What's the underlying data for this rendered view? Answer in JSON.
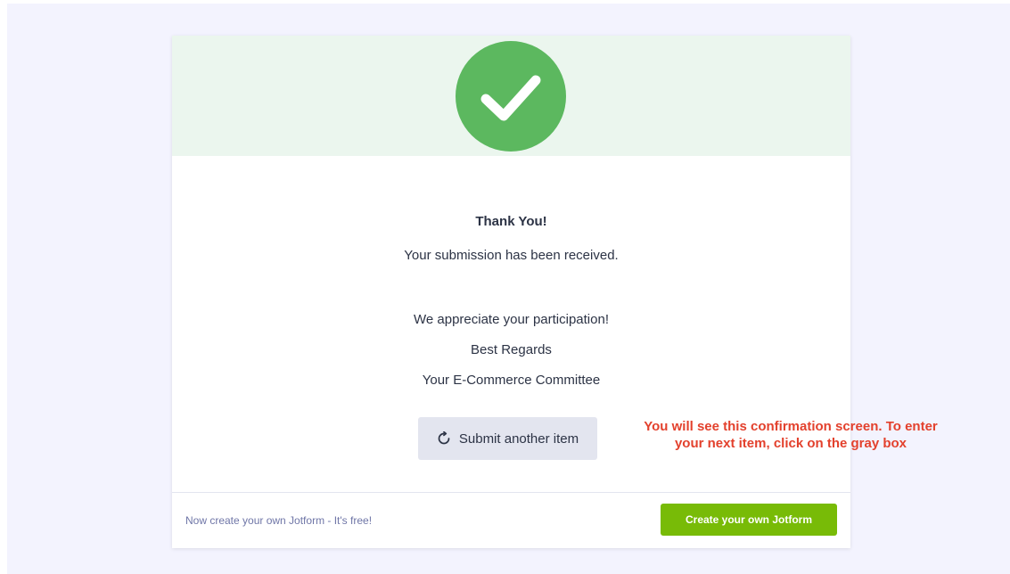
{
  "confirmation": {
    "title": "Thank You!",
    "received": "Your submission has been received.",
    "appreciate": "We appreciate your participation!",
    "regards": "Best Regards",
    "signature": "Your E-Commerce Committee",
    "success_icon": "check-circle-icon"
  },
  "actions": {
    "submit_another_label": "Submit another item",
    "submit_another_icon": "refresh-icon"
  },
  "footer": {
    "promo_text": "Now create your own Jotform - It's free!",
    "create_button_label": "Create your own Jotform"
  },
  "annotation": {
    "line1": "You will see this confirmation screen.  To enter",
    "line2": "your next item, click on the gray box"
  },
  "colors": {
    "success_green": "#5cb85f",
    "hero_background": "#ebf6ee",
    "create_button": "#78bb07",
    "annotation_red": "#e3412d",
    "submit_button": "#e3e5ef"
  }
}
